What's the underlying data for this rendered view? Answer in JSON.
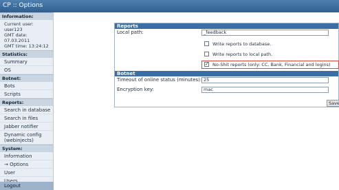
{
  "app": {
    "title": "CP :: Options"
  },
  "sidebar": {
    "information": {
      "heading": "Information:",
      "current_user": "Current user: user123",
      "gmt_date": "GMT date: 07.03.2011",
      "gmt_time": "GMT time: 13:24:12"
    },
    "statistics": {
      "heading": "Statistics:",
      "items": [
        "Summary",
        "OS"
      ]
    },
    "botnet": {
      "heading": "Botnet:",
      "items": [
        "Bots",
        "Scripts"
      ]
    },
    "reports": {
      "heading": "Reports:",
      "items": [
        "Search in database",
        "Search in files",
        "Jabber notifier",
        "Dynamic config (webinjects)"
      ]
    },
    "system": {
      "heading": "System:",
      "items": [
        "Information",
        "→ Options",
        "User",
        "Users"
      ]
    },
    "logout": "Logout"
  },
  "reports": {
    "heading": "Reports",
    "local_path_label": "Local path:",
    "local_path_value": "_feedback",
    "write_db_label": "Write reports to database.",
    "write_db_checked": "",
    "write_local_label": "Write reports to local path.",
    "write_local_checked": "",
    "noshit_label": "No-Shit reports (only: CC, Bank, Financial and logins)",
    "noshit_checked": "✓"
  },
  "botnet": {
    "heading": "Botnet",
    "timeout_label": "Timeout of online status (minutes):",
    "timeout_value": "25",
    "key_label": "Encryption key:",
    "key_value": "mac"
  },
  "save_label": "Save"
}
